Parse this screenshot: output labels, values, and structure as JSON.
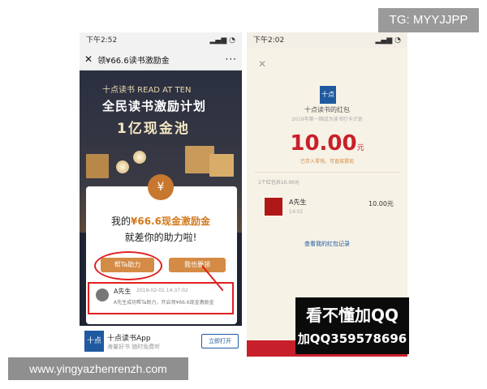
{
  "watermark": {
    "tg": "TG: MYYJJPP",
    "url": "www.yingyazhenrenzh.com"
  },
  "left": {
    "status": {
      "time": "下午2:52"
    },
    "nav": {
      "title": "领¥66.6读书激励金",
      "more": "···",
      "close": "✕"
    },
    "brand": "十点读书 READ AT TEN",
    "headline": "全民读书激励计划",
    "pool": "1亿现金池",
    "card": {
      "title_prefix": "我的",
      "title_amount": "¥66.6现金激励金",
      "subtitle": "就差你的助力啦!",
      "help_button": "帮Ta助力",
      "want_button": "我也要领",
      "helper": {
        "name": "A先生",
        "date": "2019-02-01 14:37:02",
        "text": "A先生成功帮Ta助力，开启领¥66.6现金激励金"
      }
    },
    "app": {
      "name": "十点读书App",
      "desc": "海量好书 随时免费听",
      "open": "立即打开",
      "logo": "十点"
    }
  },
  "right": {
    "status": {
      "time": "下午2:02"
    },
    "close": "✕",
    "logo": "十点",
    "title": "十点读书的红包",
    "subtitle": "2019年第一期成为读书打卡计划",
    "amount": "10.00",
    "unit": "元",
    "note": "已存入零钱，可直接提现",
    "count": "1个红包共10.00元",
    "recipient": {
      "name": "A先生",
      "time": "14:02",
      "amount": "10.00元"
    },
    "link": "查看我的红包记录"
  },
  "ad": {
    "line1": "看不懂加QQ",
    "line2": "加QQ359578696"
  }
}
